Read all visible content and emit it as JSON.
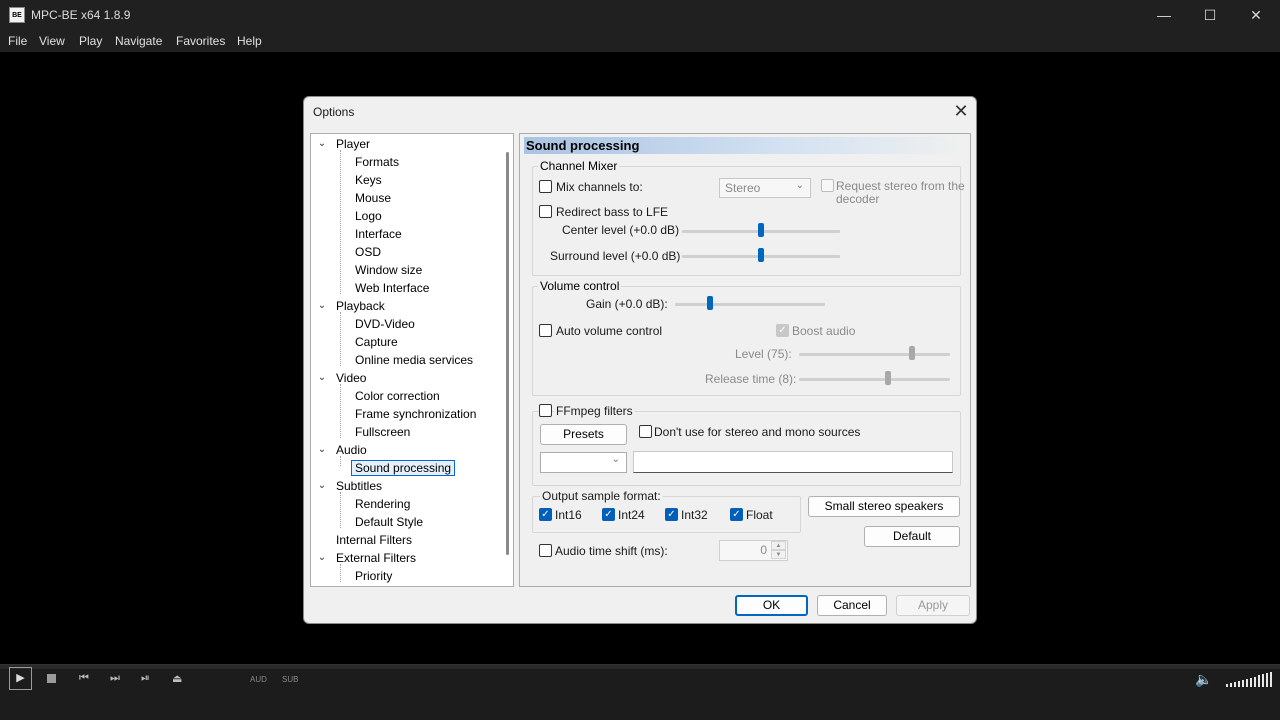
{
  "window": {
    "title": "MPC-BE x64 1.8.9",
    "icon_text": "BE",
    "controls": {
      "minimize": "—",
      "maximize": "☐",
      "close": "✕"
    }
  },
  "menubar": [
    "File",
    "View",
    "Play",
    "Navigate",
    "Favorites",
    "Help"
  ],
  "dialog": {
    "title": "Options",
    "close": "✕",
    "tree": [
      {
        "label": "Player",
        "expanded": true,
        "children": [
          "Formats",
          "Keys",
          "Mouse",
          "Logo",
          "Interface",
          "OSD",
          "Window size",
          "Web Interface"
        ]
      },
      {
        "label": "Playback",
        "expanded": true,
        "children": [
          "DVD-Video",
          "Capture",
          "Online media services"
        ]
      },
      {
        "label": "Video",
        "expanded": true,
        "children": [
          "Color correction",
          "Frame synchronization",
          "Fullscreen"
        ]
      },
      {
        "label": "Audio",
        "expanded": true,
        "children": [
          "Sound processing"
        ]
      },
      {
        "label": "Subtitles",
        "expanded": true,
        "children": [
          "Rendering",
          "Default Style"
        ]
      },
      {
        "label": "Internal Filters",
        "expanded": false,
        "children": []
      },
      {
        "label": "External Filters",
        "expanded": true,
        "children": [
          "Priority"
        ]
      }
    ],
    "selected": "Sound processing",
    "page": {
      "header": "Sound processing",
      "channel_mixer": {
        "title": "Channel Mixer",
        "mix_channels_label": "Mix channels to:",
        "mix_channels_checked": false,
        "mix_combo_value": "Stereo",
        "request_stereo_label_1": "Request stereo from the",
        "request_stereo_label_2": "decoder",
        "redirect_bass_label": "Redirect bass to LFE",
        "center_level_label": "Center level (+0.0 dB)",
        "center_level_fraction": 0.5,
        "surround_level_label": "Surround level (+0.0 dB)",
        "surround_level_fraction": 0.5
      },
      "volume_control": {
        "title": "Volume control",
        "gain_label": "Gain (+0.0 dB):",
        "gain_fraction": 0.23,
        "auto_volume_label": "Auto volume control",
        "boost_audio_label": "Boost audio",
        "level_label": "Level (75):",
        "level_fraction": 0.75,
        "release_label": "Release time (8):",
        "release_fraction": 0.59
      },
      "ffmpeg": {
        "title": "FFmpeg filters",
        "presets_button": "Presets",
        "dont_use_label": "Don't use for stereo and mono sources"
      },
      "output_format": {
        "title": "Output sample format:",
        "options": [
          {
            "label": "Int16",
            "checked": true
          },
          {
            "label": "Int24",
            "checked": true
          },
          {
            "label": "Int32",
            "checked": true
          },
          {
            "label": "Float",
            "checked": true
          }
        ]
      },
      "small_speakers_button": "Small stereo speakers",
      "default_button": "Default",
      "time_shift_label": "Audio time shift (ms):",
      "time_shift_value": "0"
    },
    "buttons": {
      "ok": "OK",
      "cancel": "Cancel",
      "apply": "Apply"
    }
  },
  "player_controls": {
    "aud_label": "AUD",
    "sub_label": "SUB",
    "volume_level": 1.0
  }
}
